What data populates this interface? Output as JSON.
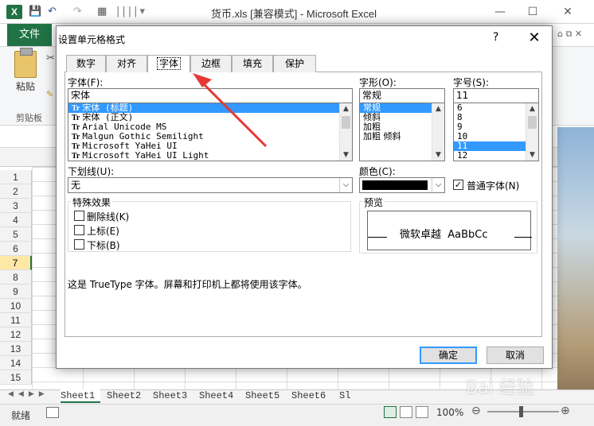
{
  "window": {
    "title": "货币.xls  [兼容模式] - Microsoft Excel",
    "app_icon": "X",
    "minimize": "—",
    "maximize": "☐",
    "close": "✕"
  },
  "ribbon": {
    "file_tab": "文件",
    "paste_label": "粘贴",
    "clipboard_group": "剪贴板"
  },
  "sheet": {
    "row_numbers": [
      "1",
      "2",
      "3",
      "4",
      "5",
      "6",
      "7",
      "8",
      "9",
      "10",
      "11",
      "12",
      "13",
      "14",
      "15"
    ],
    "selected_row": "7",
    "tabs": [
      "Sheet1",
      "Sheet2",
      "Sheet3",
      "Sheet4",
      "Sheet5",
      "Sheet6",
      "Sl"
    ],
    "active_tab": "Sheet1"
  },
  "statusbar": {
    "ready": "就绪",
    "zoom": "100%"
  },
  "dialog": {
    "title": "设置单元格格式",
    "help": "?",
    "close": "✕",
    "tabs": [
      "数字",
      "对齐",
      "字体",
      "边框",
      "填充",
      "保护"
    ],
    "active_tab": "字体",
    "font": {
      "label": "字体(F):",
      "value": "宋体",
      "list": [
        "宋体 (标题)",
        "宋体 (正文)",
        "Arial Unicode MS",
        "Malgun Gothic Semilight",
        "Microsoft YaHei UI",
        "Microsoft YaHei UI Light"
      ],
      "selected_index": 0
    },
    "style": {
      "label": "字形(O):",
      "value": "常规",
      "list": [
        "常规",
        "倾斜",
        "加粗",
        "加粗 倾斜"
      ],
      "selected_index": 0
    },
    "size": {
      "label": "字号(S):",
      "value": "11",
      "list": [
        "6",
        "8",
        "9",
        "10",
        "11",
        "12"
      ],
      "selected_index": 4
    },
    "underline": {
      "label": "下划线(U):",
      "value": "无"
    },
    "color": {
      "label": "颜色(C):",
      "swatch": "#000000"
    },
    "normal_font": {
      "label": "普通字体(N)",
      "checked": true
    },
    "effects": {
      "label": "特殊效果",
      "strikethrough": "删除线(K)",
      "superscript": "上标(E)",
      "subscript": "下标(B)"
    },
    "preview": {
      "label": "预览",
      "text": "微软卓越  AaBbCc"
    },
    "info": "这是 TrueType 字体。屏幕和打印机上都将使用该字体。",
    "ok": "确定",
    "cancel": "取消"
  },
  "watermark": "Bai 经验"
}
